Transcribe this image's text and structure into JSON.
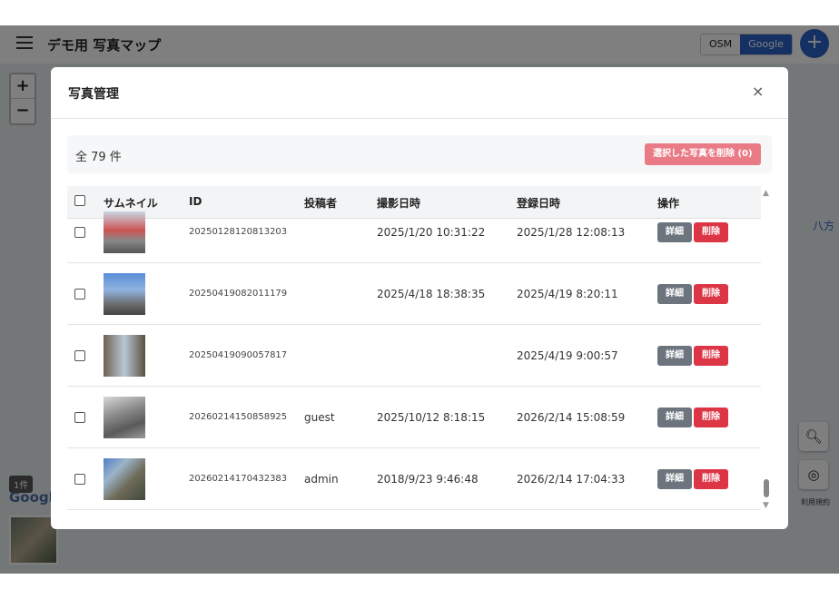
{
  "app": {
    "title": "デモ用 写真マップ",
    "map_types": [
      "OSM",
      "Google"
    ],
    "active_map_type": "Google",
    "add_label": "+"
  },
  "map": {
    "zoom_in": "+",
    "zoom_out": "−",
    "place_label": "八方",
    "marker_count": "1件",
    "google_label": "Google",
    "terms": "利用規約"
  },
  "modal": {
    "title": "写真管理",
    "close": "×",
    "total": "全 79 件",
    "bulk_delete": "選択した写真を削除 (0)",
    "columns": {
      "thumb": "サムネイル",
      "id": "ID",
      "poster": "投稿者",
      "shot_at": "撮影日時",
      "registered_at": "登録日時",
      "actions": "操作"
    },
    "detail_label": "詳細",
    "delete_label": "削除",
    "rows": [
      {
        "id": "20250128120813203",
        "poster": "",
        "shot_at": "2025/1/20 10:31:22",
        "registered_at": "2025/1/28 12:08:13",
        "detail": "詳細",
        "delete": "削除"
      },
      {
        "id": "20250419082011179",
        "poster": "",
        "shot_at": "2025/4/18 18:38:35",
        "registered_at": "2025/4/19 8:20:11",
        "detail": "詳細",
        "delete": "削除"
      },
      {
        "id": "20250419090057817",
        "poster": "",
        "shot_at": "",
        "registered_at": "2025/4/19 9:00:57",
        "detail": "詳細",
        "delete": "削除"
      },
      {
        "id": "20260214150858925",
        "poster": "guest",
        "shot_at": "2025/10/12 8:18:15",
        "registered_at": "2026/2/14 15:08:59",
        "detail": "詳細",
        "delete": "削除"
      },
      {
        "id": "20260214170432383",
        "poster": "admin",
        "shot_at": "2018/9/23 9:46:48",
        "registered_at": "2026/2/14 17:04:33",
        "detail": "詳細",
        "delete": "削除"
      }
    ]
  },
  "colors": {
    "primary": "#2b63c6",
    "danger": "#dc3545",
    "secondary": "#6c757d"
  }
}
